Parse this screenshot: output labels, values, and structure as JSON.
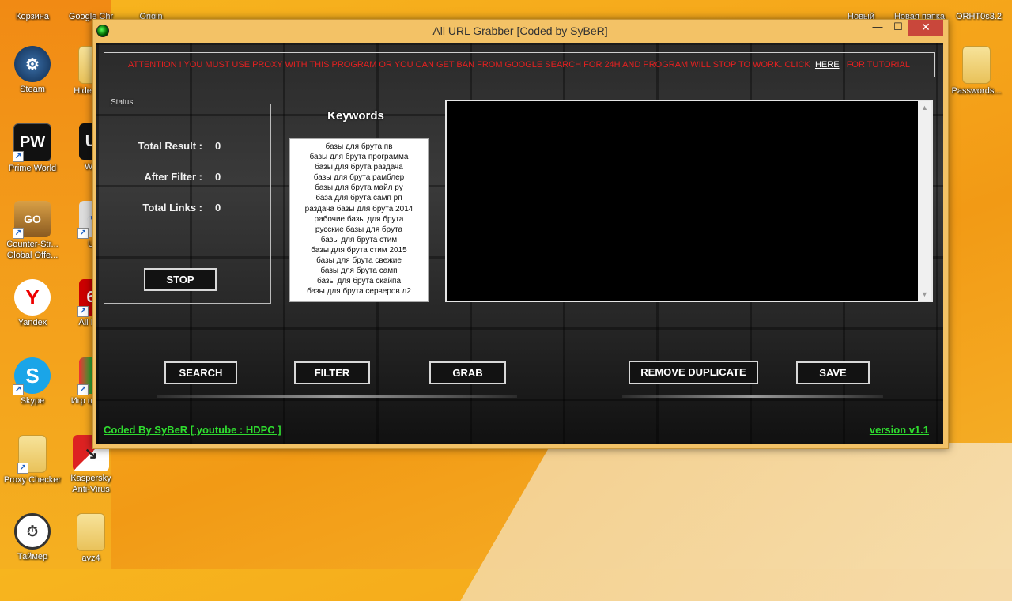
{
  "desktop": {
    "left_icons": [
      {
        "label": "Корзина"
      },
      {
        "label": "Steam"
      },
      {
        "label": "Prime World"
      },
      {
        "label": "Counter-Str... Global Offe..."
      },
      {
        "label": "Yandex"
      },
      {
        "label": "Skype"
      },
      {
        "label": "Proxy Checker"
      },
      {
        "label": "Таймер"
      }
    ],
    "second_column_icons": [
      {
        "label": "Google Chr"
      },
      {
        "label": "Hide Chr"
      },
      {
        "label": "Wa"
      },
      {
        "label": "U"
      },
      {
        "label": "All Ext"
      },
      {
        "label": "Игр центр"
      },
      {
        "label": "Kaspersky Anti-Virus"
      },
      {
        "label": "avz4"
      }
    ],
    "top_partial": [
      {
        "label": "Origin"
      },
      {
        "label": "Новый"
      },
      {
        "label": "Новая папка"
      },
      {
        "label": "ORHT0s3.2"
      }
    ],
    "right_icon": {
      "label": "Passwords..."
    }
  },
  "window": {
    "title": "All URL Grabber [Coded by SyBeR]",
    "controls": {
      "minimize": "—",
      "maximize": "☐",
      "close": "✕"
    },
    "banner": {
      "text": "ATTENTION ! YOU MUST USE PROXY WITH THIS PROGRAM OR YOU CAN GET BAN FROM GOOGLE SEARCH FOR 24H AND PROGRAM WILL STOP TO WORK. CLICK",
      "link": "HERE",
      "suffix": "FOR TUTORIAL"
    },
    "status": {
      "legend": "Status",
      "rows": [
        {
          "label": "Total Result :",
          "value": "0"
        },
        {
          "label": "After Filter :",
          "value": "0"
        },
        {
          "label": "Total Links :",
          "value": "0"
        }
      ],
      "stop_button": "STOP"
    },
    "keywords": {
      "title": "Keywords",
      "items": [
        "базы для брута пв",
        "базы для брута программа",
        "базы для брута раздача",
        "базы для брута рамблер",
        "базы для брута майл ру",
        "база для брута самп рп",
        "раздача базы для брута 2014",
        "рабочие базы для брута",
        "русские базы для брута",
        "базы для брута стим",
        "базы для брута стим 2015",
        "базы для брута свежие",
        "базы для брута самп",
        "базы для брута скайпа",
        "базы для брута серверов л2"
      ]
    },
    "buttons": {
      "search": "SEARCH",
      "filter": "FILTER",
      "grab": "GRAB",
      "remove_duplicate": "REMOVE DUPLICATE",
      "save": "SAVE"
    },
    "footer": {
      "credit": "Coded By SyBeR [ youtube : HDPC ]",
      "version": "version v1.1"
    }
  }
}
